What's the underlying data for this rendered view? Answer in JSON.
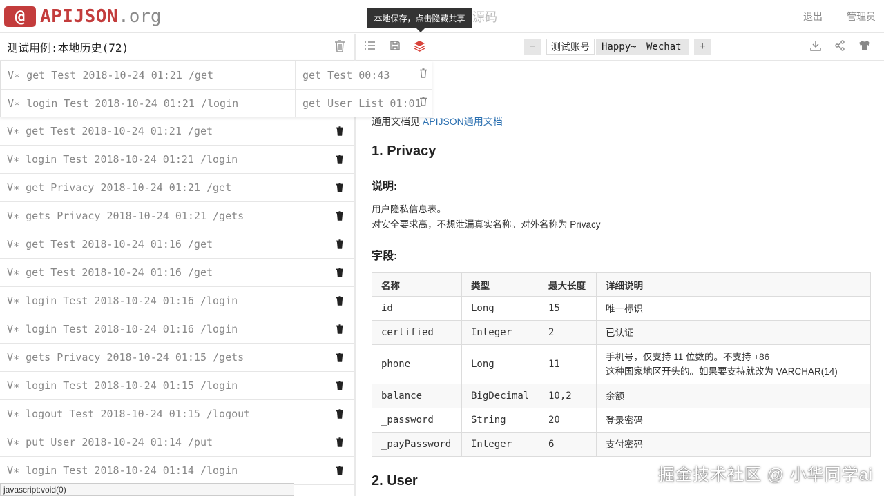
{
  "header": {
    "logo_mark": "@",
    "logo_text": "APIJSON",
    "logo_suffix": ".org",
    "faded_text": "源码",
    "tooltip": "本地保存，点击隐藏共享",
    "logout": "退出",
    "admin": "管理员"
  },
  "left": {
    "title": "测试用例:本地历史(72)",
    "items": [
      "V∗ get Test 2018-10-24 01:21 /get",
      "V∗ login Test 2018-10-24 01:21 /login",
      "V∗ get Test 2018-10-24 01:21 /get",
      "V∗ login Test 2018-10-24 01:21 /login",
      "V∗ get Privacy 2018-10-24 01:21 /get",
      "V∗ gets Privacy 2018-10-24 01:21 /gets",
      "V∗ get Test 2018-10-24 01:16 /get",
      "V∗ get Test 2018-10-24 01:16 /get",
      "V∗ login Test 2018-10-24 01:16 /login",
      "V∗ login Test 2018-10-24 01:16 /login",
      "V∗ gets Privacy 2018-10-24 01:15 /gets",
      "V∗ login Test 2018-10-24 01:15 /login",
      "V∗ logout Test 2018-10-24 01:15 /logout",
      "V∗ put User 2018-10-24 01:14 /put",
      "V∗ login Test 2018-10-24 01:14 /login"
    ]
  },
  "dropdown": {
    "shared": [
      "get Test 00:43",
      "get User List 01:01"
    ]
  },
  "toolbar": {
    "minus": "−",
    "plus": "+",
    "account_label": "测试账号",
    "account_name": "Happy~ Wechat"
  },
  "doc": {
    "ref_prefix": "通用文档见",
    "ref_link": "APIJSON通用文档",
    "h1": "1. Privacy",
    "desc_title": "说明:",
    "desc_line1": "用户隐私信息表。",
    "desc_line2": "对安全要求高，不想泄漏真实名称。对外名称为 Privacy",
    "fields_title": "字段:",
    "table": {
      "headers": [
        "名称",
        "类型",
        "最大长度",
        "详细说明"
      ],
      "rows": [
        [
          "id",
          "Long",
          "15",
          "唯一标识"
        ],
        [
          "certified",
          "Integer",
          "2",
          "已认证"
        ],
        [
          "phone",
          "Long",
          "11",
          "手机号，仅支持 11 位数的。不支持 +86",
          "这种国家地区开头的。如果要支持就改为 VARCHAR(14)"
        ],
        [
          "balance",
          "BigDecimal",
          "10,2",
          "余额"
        ],
        [
          "_password",
          "String",
          "20",
          "登录密码"
        ],
        [
          "_payPassword",
          "Integer",
          "6",
          "支付密码"
        ]
      ]
    },
    "h2": "2. User"
  },
  "status_bar": "javascript:void(0)",
  "watermark": "掘金技术社区 @ 小华同学ai",
  "colors": {
    "brand": "#c33c3c",
    "link": "#2a6fb0",
    "tooltip_bg": "#333333",
    "share_icon": "#d9443b"
  }
}
